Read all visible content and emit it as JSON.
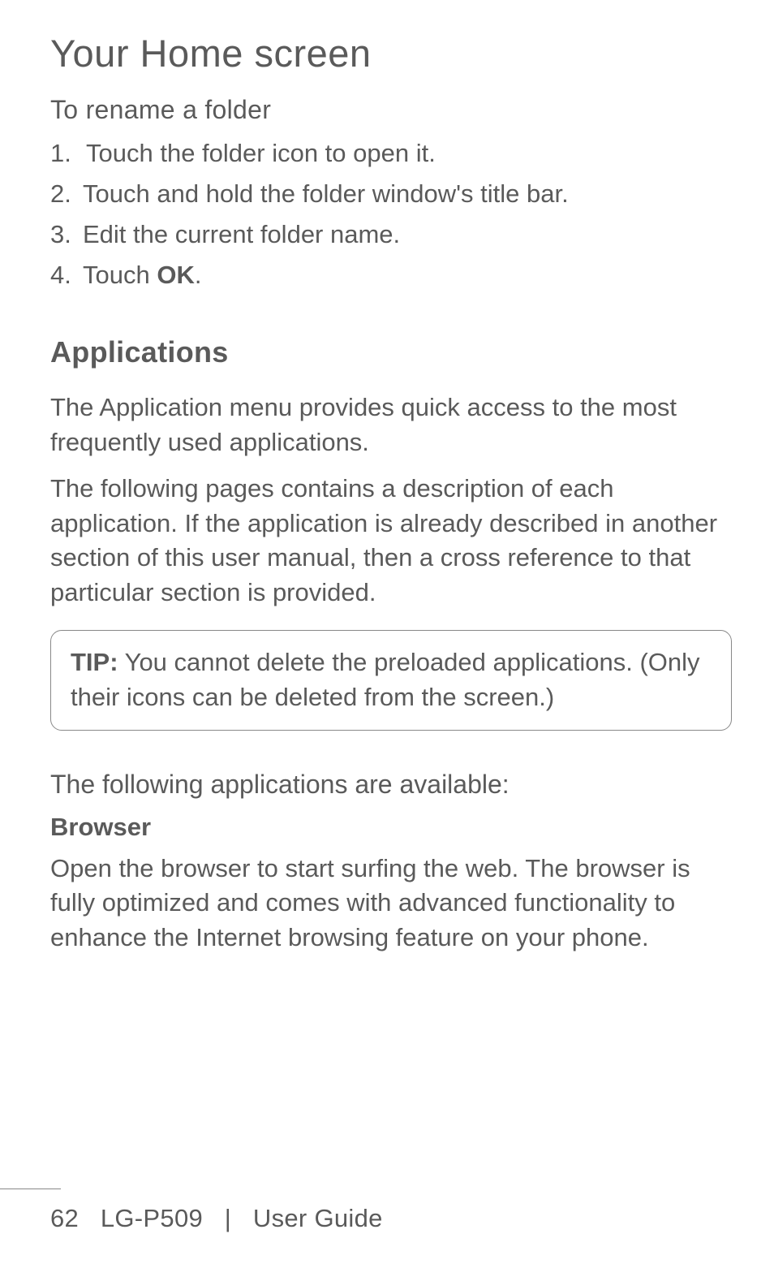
{
  "page": {
    "title": "Your Home screen"
  },
  "rename_section": {
    "heading": "To rename a folder",
    "steps": [
      {
        "num": "1.",
        "text": "Touch the folder icon to open it."
      },
      {
        "num": "2.",
        "text": "Touch and hold the folder window's title bar."
      },
      {
        "num": "3.",
        "text": "Edit the current folder name."
      },
      {
        "num": "4.",
        "text_prefix": "Touch ",
        "text_bold": "OK",
        "text_suffix": "."
      }
    ]
  },
  "applications": {
    "heading": "Applications",
    "para1": "The Application menu provides quick access to the most frequently used applications.",
    "para2": "The following pages contains a description of each application. If the application is already described in another section of this user manual, then a cross reference to that particular section is provided."
  },
  "tip": {
    "label": "TIP:",
    "text": " You cannot delete the preloaded applications. (Only their icons can be deleted from the screen.)"
  },
  "apps_list": {
    "heading": "The following applications are available:",
    "browser": {
      "title": "Browser",
      "text": "Open the browser to start surfing the web. The browser is fully optimized and comes with advanced functionality to enhance the Internet browsing feature on your phone."
    }
  },
  "footer": {
    "page_num": "62",
    "model": "LG-P509",
    "separator": "|",
    "label": "User Guide"
  }
}
